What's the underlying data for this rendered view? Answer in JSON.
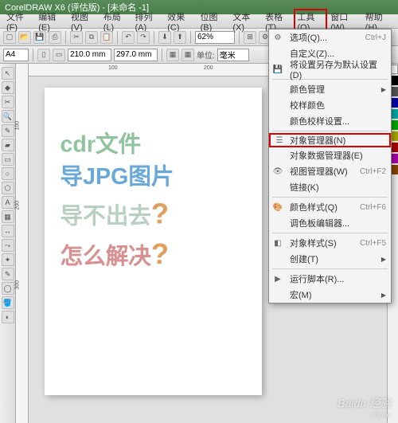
{
  "title": "CorelDRAW X6 (评估版) - [未命名 -1]",
  "menu": {
    "file": "文件(F)",
    "edit": "编辑(E)",
    "view": "视图(V)",
    "layout": "布局(L)",
    "arrange": "排列(A)",
    "effects": "效果(C)",
    "bitmap": "位图(B)",
    "text": "文本(X)",
    "table": "表格(T)",
    "tools": "工具(O)",
    "window": "窗口(W)",
    "help": "帮助(H)"
  },
  "toolbar": {
    "zoom": "62%",
    "page_size": "A4",
    "width": "210.0 mm",
    "height": "297.0 mm",
    "units": "毫米",
    "units_label": "单位:"
  },
  "page_text": {
    "line1": "cdr文件",
    "line2": "导JPG图片",
    "line3": "导不出去",
    "line4": "怎么解决",
    "qmark": "?"
  },
  "dropdown": {
    "options": "选项(Q)...",
    "options_shortcut": "Ctrl+J",
    "customize": "自定义(Z)...",
    "save_default": "将设置另存为默认设置(D)",
    "color_mgmt": "颜色管理",
    "proof_color": "校样颜色",
    "proof_settings": "颜色校样设置...",
    "obj_manager": "对象管理器(N)",
    "obj_data_mgr": "对象数据管理器(E)",
    "view_mgr": "视图管理器(W)",
    "view_mgr_shortcut": "Ctrl+F2",
    "link_mgr": "链接(K)",
    "color_styles": "颜色样式(Q)",
    "color_styles_shortcut": "Ctrl+F6",
    "palette_editor": "调色板编辑器...",
    "obj_styles": "对象样式(S)",
    "obj_styles_shortcut": "Ctrl+F5",
    "create": "创建(T)",
    "run_script": "运行脚本(R)...",
    "macro": "宏(M)"
  },
  "ruler_h": [
    "100",
    "200"
  ],
  "ruler_v": [
    "100",
    "200",
    "300"
  ],
  "watermark": "Baidu 经验",
  "watermark_sub": "jingyan"
}
